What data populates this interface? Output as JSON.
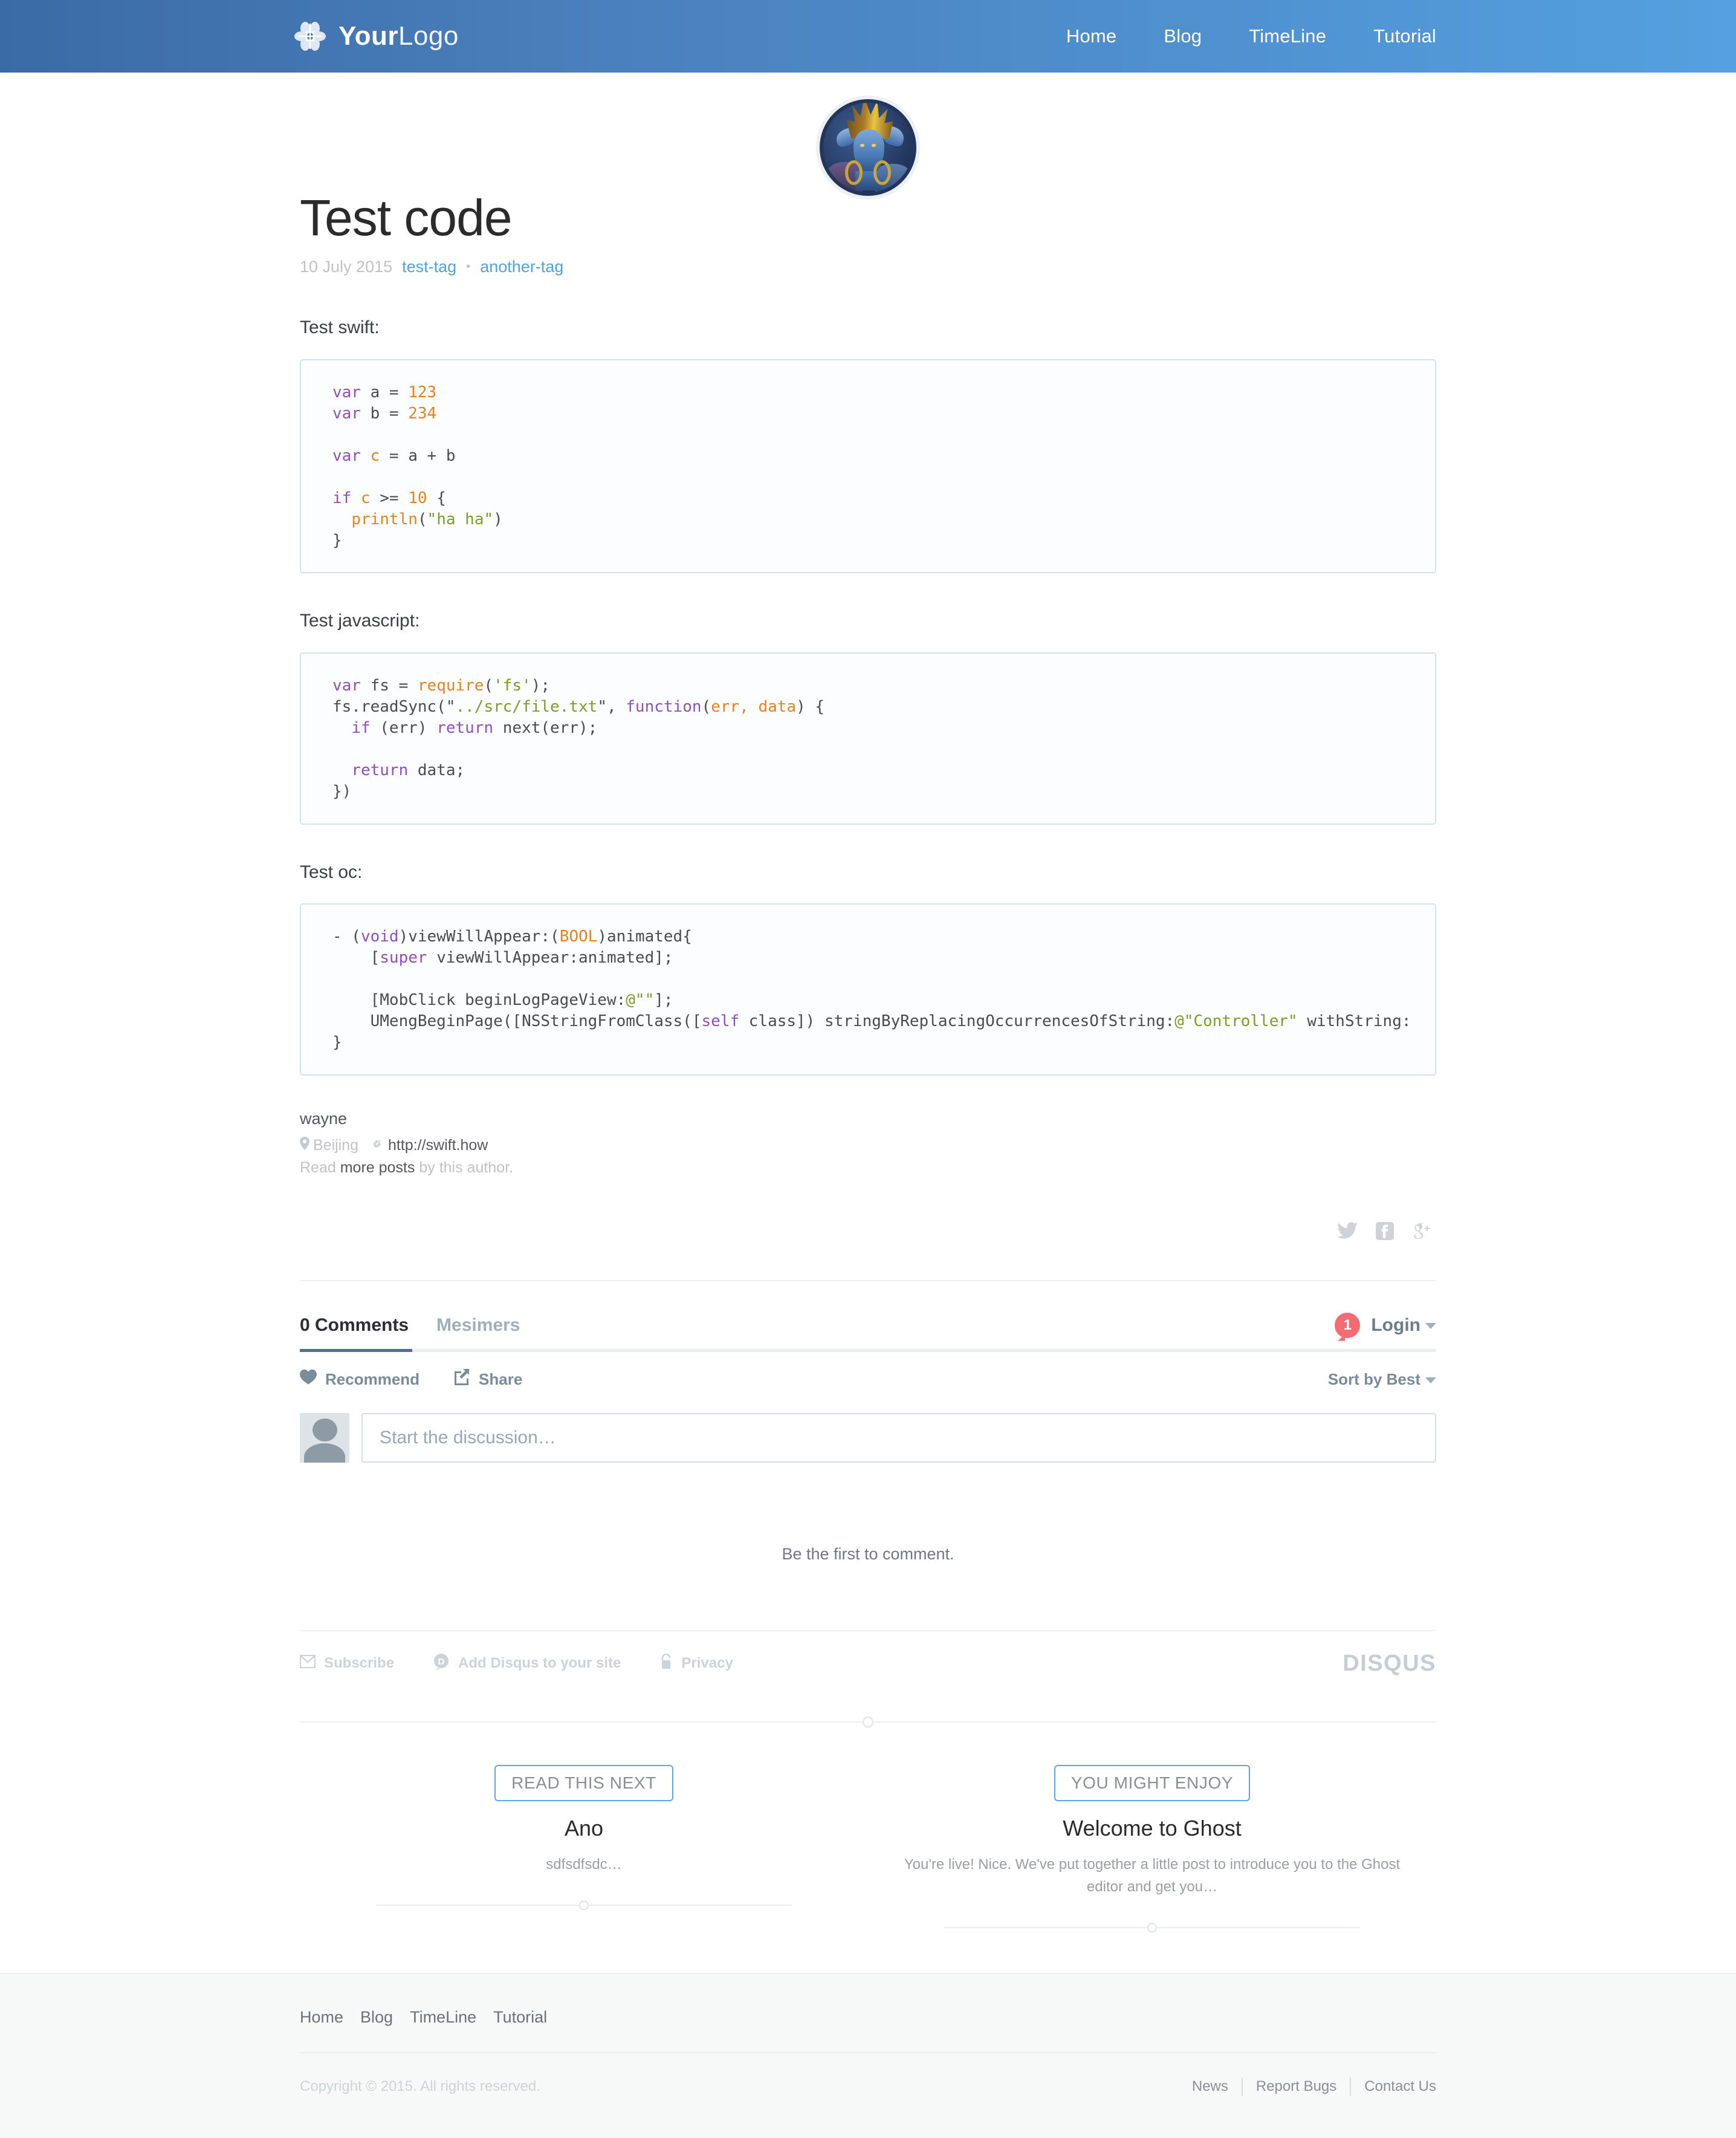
{
  "header": {
    "logo_bold": "Your",
    "logo_light": "Logo",
    "nav": [
      {
        "label": "Home"
      },
      {
        "label": "Blog"
      },
      {
        "label": "TimeLine"
      },
      {
        "label": "Tutorial"
      }
    ]
  },
  "post": {
    "title": "Test code",
    "date": "10 July 2015",
    "tag_separator": "•",
    "tags": [
      {
        "label": "test-tag"
      },
      {
        "label": "another-tag"
      }
    ],
    "sections": [
      {
        "heading": "Test swift:",
        "lines": [
          [
            {
              "t": "var",
              "c": "k"
            },
            {
              "t": " a = ",
              "c": "p"
            },
            {
              "t": "123",
              "c": "n"
            }
          ],
          [
            {
              "t": "var",
              "c": "k"
            },
            {
              "t": " b = ",
              "c": "p"
            },
            {
              "t": "234",
              "c": "n"
            }
          ],
          [
            {
              "t": "",
              "c": "p"
            }
          ],
          [
            {
              "t": "var",
              "c": "k"
            },
            {
              "t": " ",
              "c": "p"
            },
            {
              "t": "c",
              "c": "n"
            },
            {
              "t": " = a + b",
              "c": "p"
            }
          ],
          [
            {
              "t": "",
              "c": "p"
            }
          ],
          [
            {
              "t": "if",
              "c": "k"
            },
            {
              "t": " ",
              "c": "p"
            },
            {
              "t": "c",
              "c": "n"
            },
            {
              "t": " >= ",
              "c": "p"
            },
            {
              "t": "10",
              "c": "n"
            },
            {
              "t": " {",
              "c": "p"
            }
          ],
          [
            {
              "t": "  ",
              "c": "p"
            },
            {
              "t": "println",
              "c": "n"
            },
            {
              "t": "(",
              "c": "p"
            },
            {
              "t": "\"ha ha\"",
              "c": "s"
            },
            {
              "t": ")",
              "c": "p"
            }
          ],
          [
            {
              "t": "}",
              "c": "p"
            }
          ]
        ]
      },
      {
        "heading": "Test javascript:",
        "lines": [
          [
            {
              "t": "var",
              "c": "k"
            },
            {
              "t": " fs = ",
              "c": "p"
            },
            {
              "t": "require",
              "c": "n"
            },
            {
              "t": "(",
              "c": "p"
            },
            {
              "t": "'fs'",
              "c": "s"
            },
            {
              "t": ");",
              "c": "p"
            }
          ],
          [
            {
              "t": "fs.readSync(\"",
              "c": "p"
            },
            {
              "t": "../src/file.txt",
              "c": "s"
            },
            {
              "t": "\", ",
              "c": "p"
            },
            {
              "t": "function",
              "c": "k"
            },
            {
              "t": "(",
              "c": "p"
            },
            {
              "t": "err, data",
              "c": "n"
            },
            {
              "t": ") {",
              "c": "p"
            }
          ],
          [
            {
              "t": "  ",
              "c": "p"
            },
            {
              "t": "if",
              "c": "k"
            },
            {
              "t": " (err) ",
              "c": "p"
            },
            {
              "t": "return",
              "c": "k"
            },
            {
              "t": " next(err);",
              "c": "p"
            }
          ],
          [
            {
              "t": "",
              "c": "p"
            }
          ],
          [
            {
              "t": "  ",
              "c": "p"
            },
            {
              "t": "return",
              "c": "k"
            },
            {
              "t": " data;",
              "c": "p"
            }
          ],
          [
            {
              "t": "})",
              "c": "p"
            }
          ]
        ]
      },
      {
        "heading": "Test oc:",
        "lines": [
          [
            {
              "t": "- (",
              "c": "p"
            },
            {
              "t": "void",
              "c": "k"
            },
            {
              "t": ")viewWillAppear:(",
              "c": "p"
            },
            {
              "t": "BOOL",
              "c": "n"
            },
            {
              "t": ")animated{",
              "c": "p"
            }
          ],
          [
            {
              "t": "    [",
              "c": "p"
            },
            {
              "t": "super",
              "c": "k"
            },
            {
              "t": " viewWillAppear:animated];",
              "c": "p"
            }
          ],
          [
            {
              "t": "",
              "c": "p"
            }
          ],
          [
            {
              "t": "    [MobClick beginLogPageView:",
              "c": "p"
            },
            {
              "t": "@\"\"",
              "c": "s"
            },
            {
              "t": "];",
              "c": "p"
            }
          ],
          [
            {
              "t": "    UMengBeginPage([NSStringFromClass([",
              "c": "p"
            },
            {
              "t": "self",
              "c": "k"
            },
            {
              "t": " class]) stringByReplacingOccurrencesOfString:",
              "c": "p"
            },
            {
              "t": "@\"Controller\"",
              "c": "s"
            },
            {
              "t": " withString:",
              "c": "p"
            }
          ],
          [
            {
              "t": "}",
              "c": "p"
            }
          ]
        ]
      }
    ]
  },
  "author": {
    "name": "wayne",
    "location": "Beijing",
    "website": "http://swift.how",
    "read_prefix": "Read",
    "read_link": "more posts",
    "read_suffix": "by this author."
  },
  "share": {
    "icons": [
      {
        "name": "twitter-icon"
      },
      {
        "name": "facebook-icon"
      },
      {
        "name": "googleplus-icon"
      }
    ]
  },
  "disqus": {
    "tab_comments": "0 Comments",
    "tab_site": "Mesimers",
    "login_badge": "1",
    "login_label": "Login",
    "recommend_label": "Recommend",
    "share_label": "Share",
    "sort_label": "Sort by Best",
    "input_placeholder": "Start the discussion…",
    "empty_message": "Be the first to comment.",
    "footer_links": [
      {
        "label": "Subscribe",
        "icon": "envelope-icon"
      },
      {
        "label": "Add Disqus to your site",
        "icon": "disqus-d-icon"
      },
      {
        "label": "Privacy",
        "icon": "lock-icon"
      }
    ],
    "logo": "DISQUS"
  },
  "related": [
    {
      "pill": "READ THIS NEXT",
      "title": "Ano",
      "excerpt": "sdfsdfsdc…"
    },
    {
      "pill": "YOU MIGHT ENJOY",
      "title": "Welcome to Ghost",
      "excerpt": "You're live! Nice. We've put together a little post to introduce you to the Ghost editor and get you…"
    }
  ],
  "footer": {
    "nav": [
      {
        "label": "Home"
      },
      {
        "label": "Blog"
      },
      {
        "label": "TimeLine"
      },
      {
        "label": "Tutorial"
      }
    ],
    "copyright": "Copyright © 2015. All rights reserved.",
    "links": [
      {
        "label": "News"
      },
      {
        "label": "Report Bugs"
      },
      {
        "label": "Contact Us"
      }
    ]
  },
  "colors": {
    "header_start": "#3b6ba5",
    "header_end": "#54a0e0",
    "link": "#4fa3e3",
    "code_border": "#cfe4f5",
    "badge": "#f46b74"
  }
}
